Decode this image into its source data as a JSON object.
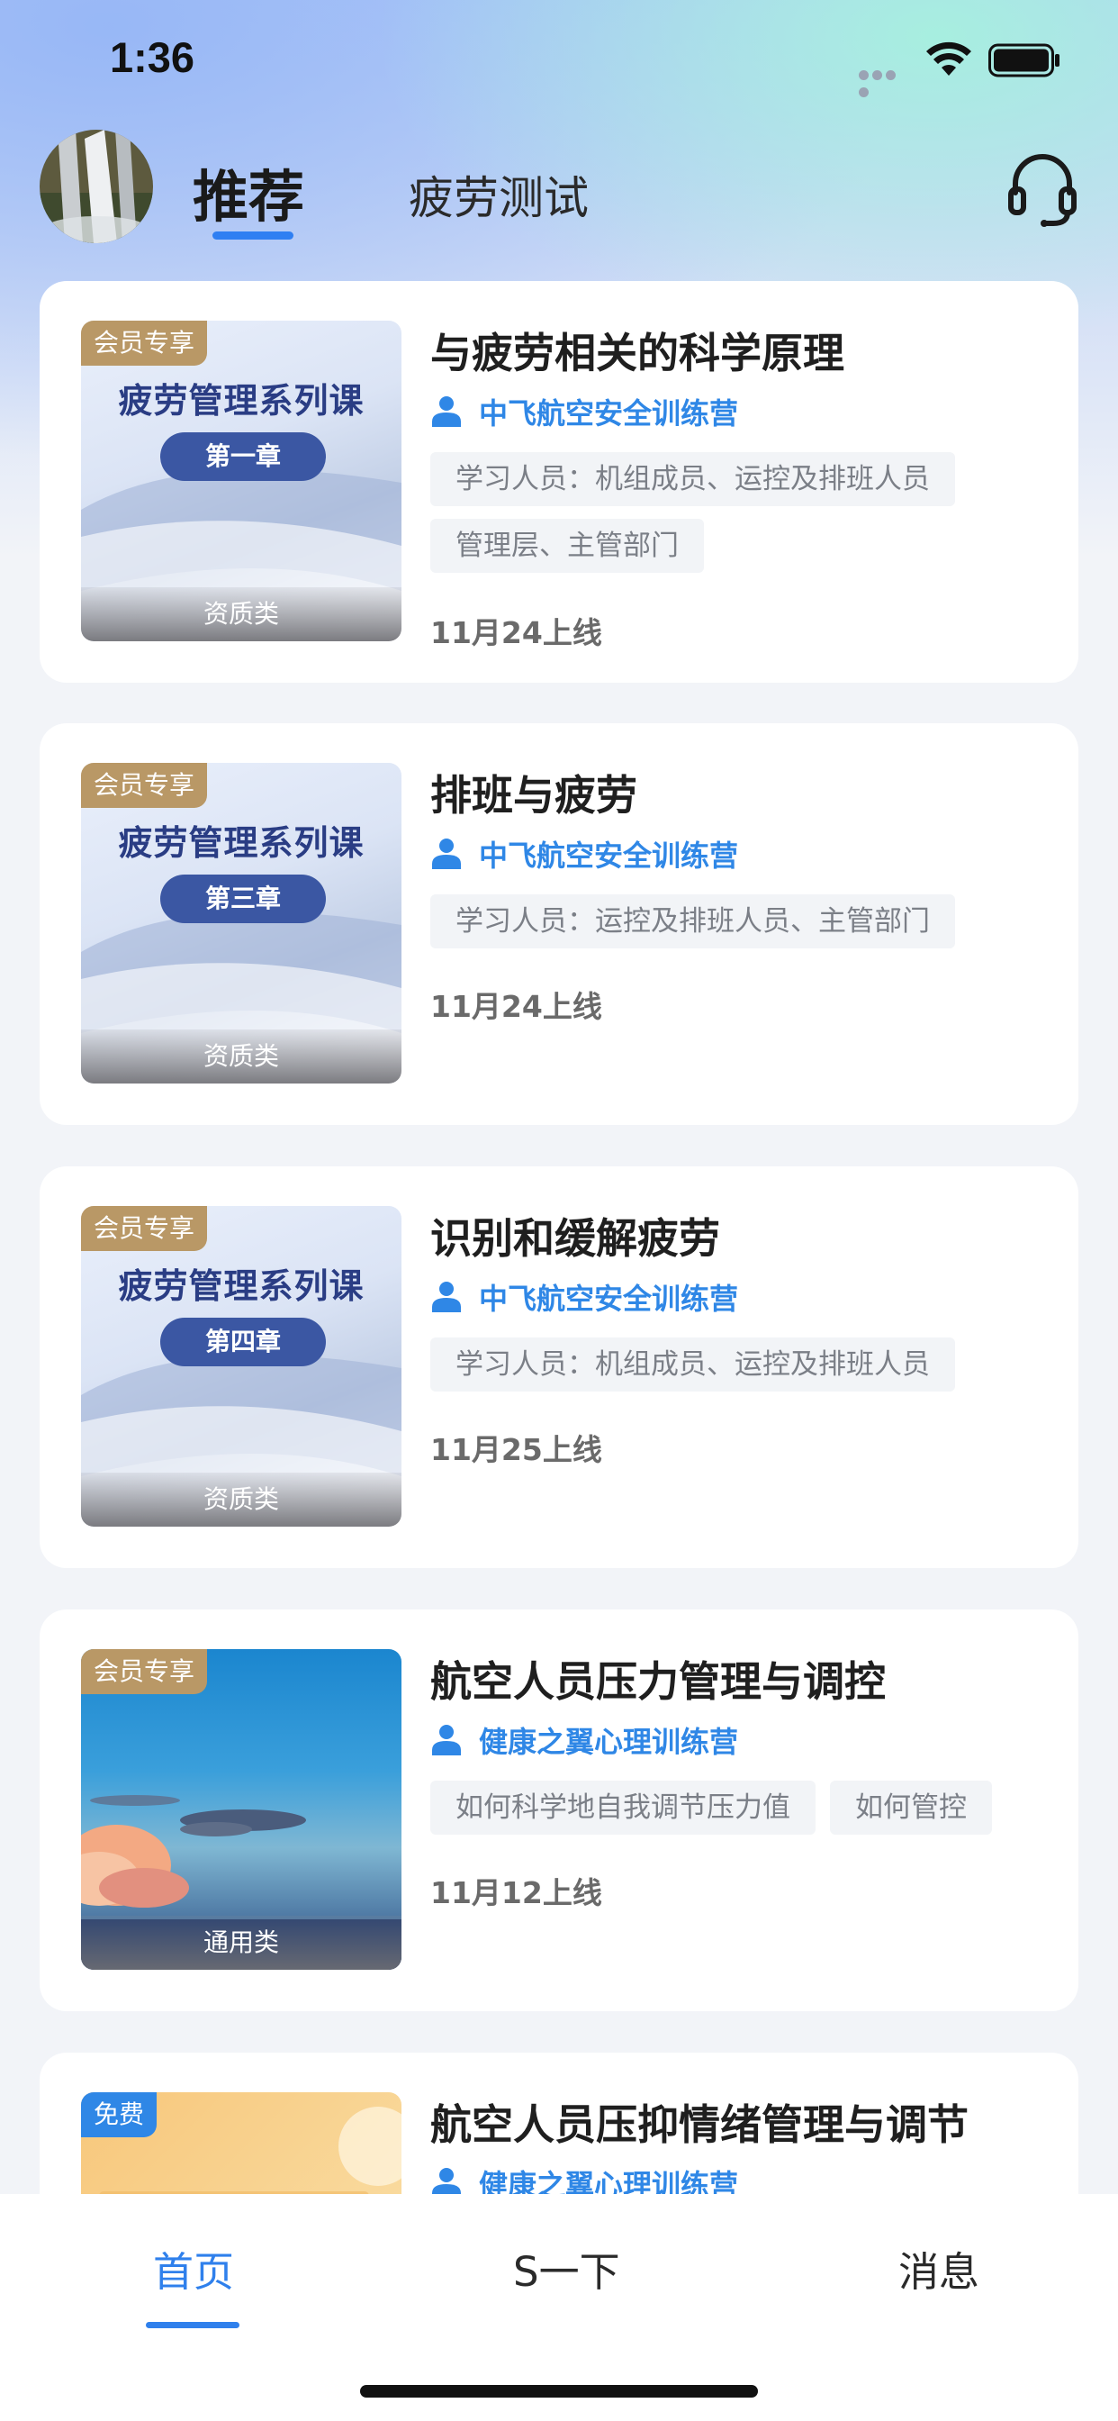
{
  "status_bar": {
    "time": "1:36"
  },
  "header": {
    "tabs": [
      {
        "label": "推荐",
        "active": true
      },
      {
        "label": "疲劳测试",
        "active": false
      }
    ],
    "support_icon": "headset-icon",
    "avatar_icon": "avatar-waterfall"
  },
  "courses": [
    {
      "badge": "会员专享",
      "thumb_title": "疲劳管理系列课",
      "thumb_chapter": "第一章",
      "thumb_category": "资质类",
      "title": "与疲劳相关的科学原理",
      "author": "中飞航空安全训练营",
      "tags": [
        "学习人员：机组成员、运控及排班人员",
        "管理层、主管部门"
      ],
      "date": "11月24上线"
    },
    {
      "badge": "会员专享",
      "thumb_title": "疲劳管理系列课",
      "thumb_chapter": "第三章",
      "thumb_category": "资质类",
      "title": "排班与疲劳",
      "author": "中飞航空安全训练营",
      "tags": [
        "学习人员：运控及排班人员、主管部门"
      ],
      "date": "11月24上线"
    },
    {
      "badge": "会员专享",
      "thumb_title": "疲劳管理系列课",
      "thumb_chapter": "第四章",
      "thumb_category": "资质类",
      "title": "识别和缓解疲劳",
      "author": "中飞航空安全训练营",
      "tags": [
        "学习人员：机组成员、运控及排班人员"
      ],
      "date": "11月25上线"
    },
    {
      "badge": "会员专享",
      "thumb_category": "通用类",
      "title": "航空人员压力管理与调控",
      "author": "健康之翼心理训练营",
      "tags": [
        "如何科学地自我调节压力值",
        "如何管控"
      ],
      "date": "11月12上线"
    },
    {
      "badge": "免费",
      "title": "航空人员压抑情绪管理与调节",
      "author": "健康之翼心理训练营"
    }
  ],
  "bottom_nav": [
    {
      "label": "首页",
      "active": true
    },
    {
      "label": "S一下",
      "active": false
    },
    {
      "label": "消息",
      "active": false
    }
  ],
  "colors": {
    "accent": "#2f80ec",
    "member_badge": "#b99866",
    "free_badge": "#2f87e6"
  }
}
